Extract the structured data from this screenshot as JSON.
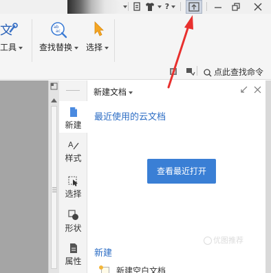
{
  "titlebar": {
    "help_label": "?",
    "colors": {
      "pin_button_bg": "#cfd6e2"
    },
    "icons": [
      "pin-icon",
      "tshirt-icon",
      "help-icon",
      "minimize-icon",
      "restore-icon",
      "close-icon",
      "upload-icon"
    ]
  },
  "ribbon": {
    "tool_partial_char": "文",
    "tools_label": "工具",
    "find_replace_label": "查找替换",
    "select_label": "选择",
    "search_command_label": "点此查找命令"
  },
  "side_tools": {
    "items": [
      {
        "label": "新建",
        "icon": "new-document-icon"
      },
      {
        "label": "样式",
        "icon": "style-icon"
      },
      {
        "label": "选择",
        "icon": "select-cursor-icon"
      },
      {
        "label": "形状",
        "icon": "shapes-icon"
      },
      {
        "label": "属性",
        "icon": "properties-icon"
      }
    ]
  },
  "task_pane": {
    "title": "新建文档",
    "recent_cloud_heading": "最近使用的云文档",
    "view_recent_button": "查看最近打开",
    "new_section_heading": "新建",
    "new_blank_doc": "新建空白文档",
    "colors": {
      "link": "#2b6cc4",
      "button": "#3a7fd5"
    }
  },
  "watermark": {
    "text": "优图推荐"
  },
  "annotation": {
    "arrow_color": "#e8302e"
  }
}
